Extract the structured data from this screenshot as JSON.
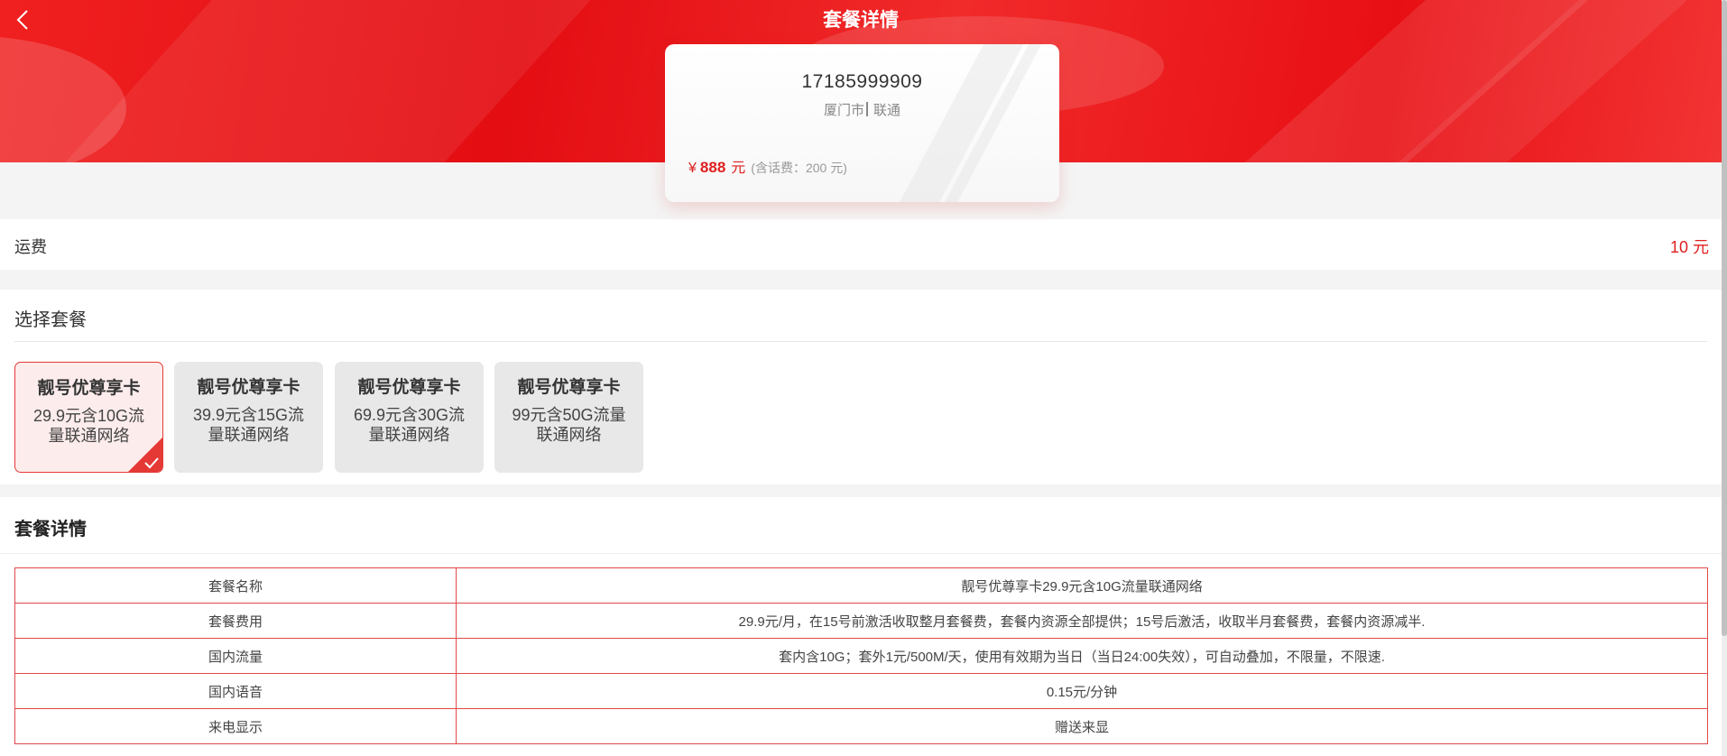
{
  "header": {
    "title": "套餐详情"
  },
  "number_card": {
    "phone_number": "17185999909",
    "city": "厦门市",
    "carrier": "联通",
    "currency_symbol": "¥",
    "price": "888",
    "price_unit": "元",
    "price_note": "(含话费：200 元)"
  },
  "shipping": {
    "label": "运费",
    "value": "10 元"
  },
  "plan_picker": {
    "title": "选择套餐",
    "options": [
      {
        "name": "靓号优尊享卡",
        "desc": "29.9元含10G流量联通网络",
        "selected": true
      },
      {
        "name": "靓号优尊享卡",
        "desc": "39.9元含15G流量联通网络",
        "selected": false
      },
      {
        "name": "靓号优尊享卡",
        "desc": "69.9元含30G流量联通网络",
        "selected": false
      },
      {
        "name": "靓号优尊享卡",
        "desc": "99元含50G流量联通网络",
        "selected": false
      }
    ]
  },
  "plan_details": {
    "title": "套餐详情",
    "rows": [
      {
        "key": "套餐名称",
        "value": "靓号优尊享卡29.9元含10G流量联通网络"
      },
      {
        "key": "套餐费用",
        "value": "29.9元/月，在15号前激活收取整月套餐费，套餐内资源全部提供；15号后激活，收取半月套餐费，套餐内资源减半."
      },
      {
        "key": "国内流量",
        "value": "套内含10G；套外1元/500M/天，使用有效期为当日（当日24:00失效），可自动叠加，不限量，不限速."
      },
      {
        "key": "国内语音",
        "value": "0.15元/分钟"
      },
      {
        "key": "来电显示",
        "value": "赠送来显"
      }
    ]
  },
  "colors": {
    "brand_red": "#e30d12",
    "accent_red": "#e02020",
    "table_border": "#e04848"
  },
  "icons": {
    "back": "chevron-left-icon",
    "selected": "checkmark-icon"
  }
}
